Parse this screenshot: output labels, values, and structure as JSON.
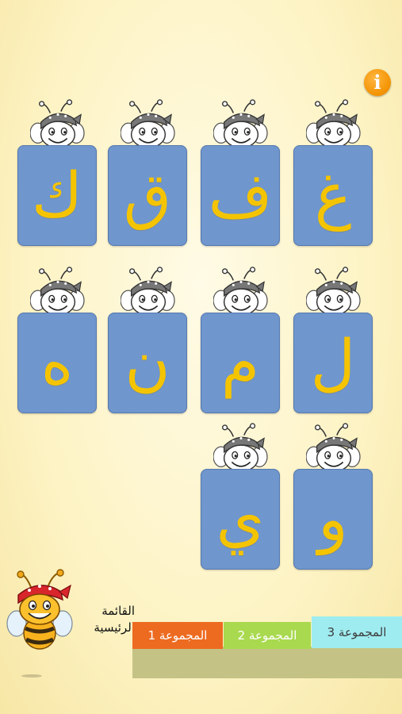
{
  "header": {
    "info_label": "i"
  },
  "cards": [
    {
      "letter": "ك"
    },
    {
      "letter": "ق"
    },
    {
      "letter": "ف"
    },
    {
      "letter": "غ"
    },
    {
      "letter": "ه"
    },
    {
      "letter": "ن"
    },
    {
      "letter": "م"
    },
    {
      "letter": "ل"
    },
    {
      "letter": "ي"
    },
    {
      "letter": "و"
    }
  ],
  "home": {
    "line1": "القائمة",
    "line2": "الرئيسية"
  },
  "tabs": [
    {
      "label": "المجموعة 1"
    },
    {
      "label": "المجموعة 2"
    },
    {
      "label": "المجموعة 3"
    }
  ],
  "colors": {
    "tile": "#6f96cd",
    "letter": "#f5c400",
    "tab1": "#ed6b21",
    "tab2": "#a9d94f",
    "tab3": "#9fecf0",
    "info": "#f39200"
  }
}
